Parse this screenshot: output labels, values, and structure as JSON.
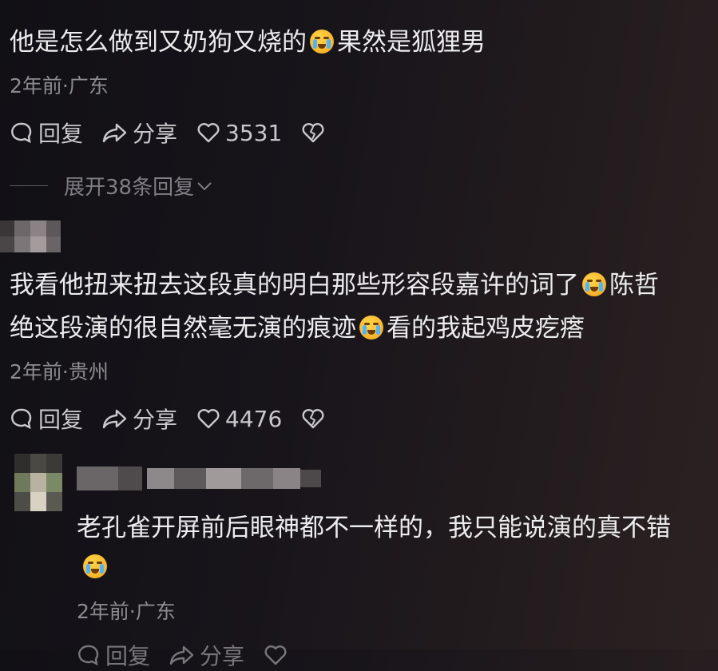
{
  "comments": [
    {
      "text_a": "他是怎么做到又奶狗又烧的",
      "text_b": "果然是狐狸男",
      "meta": "2年前·广东",
      "reply_label": "回复",
      "share_label": "分享",
      "likes": "3531",
      "expand_label": "展开38条回复"
    },
    {
      "line1_a": "我看他扭来扭去这段真的明白那些形容段嘉许的词了",
      "line1_b": "陈哲",
      "line2_a": "绝这段演的很自然毫无演的痕迹",
      "line2_b": "看的我起鸡皮疙瘩",
      "meta": "2年前·贵州",
      "reply_label": "回复",
      "share_label": "分享",
      "likes": "4476"
    },
    {
      "text": "老孔雀开屏前后眼神都不一样的，我只能说演的真不错",
      "meta": "2年前·广东",
      "reply_label": "回复",
      "share_label": "分享"
    }
  ],
  "icons": {
    "reply": "reply-bubble-icon",
    "share": "share-arrow-icon",
    "like": "heart-outline-icon",
    "dislike": "broken-heart-icon",
    "emoji": "crying-face-emoji-icon"
  }
}
